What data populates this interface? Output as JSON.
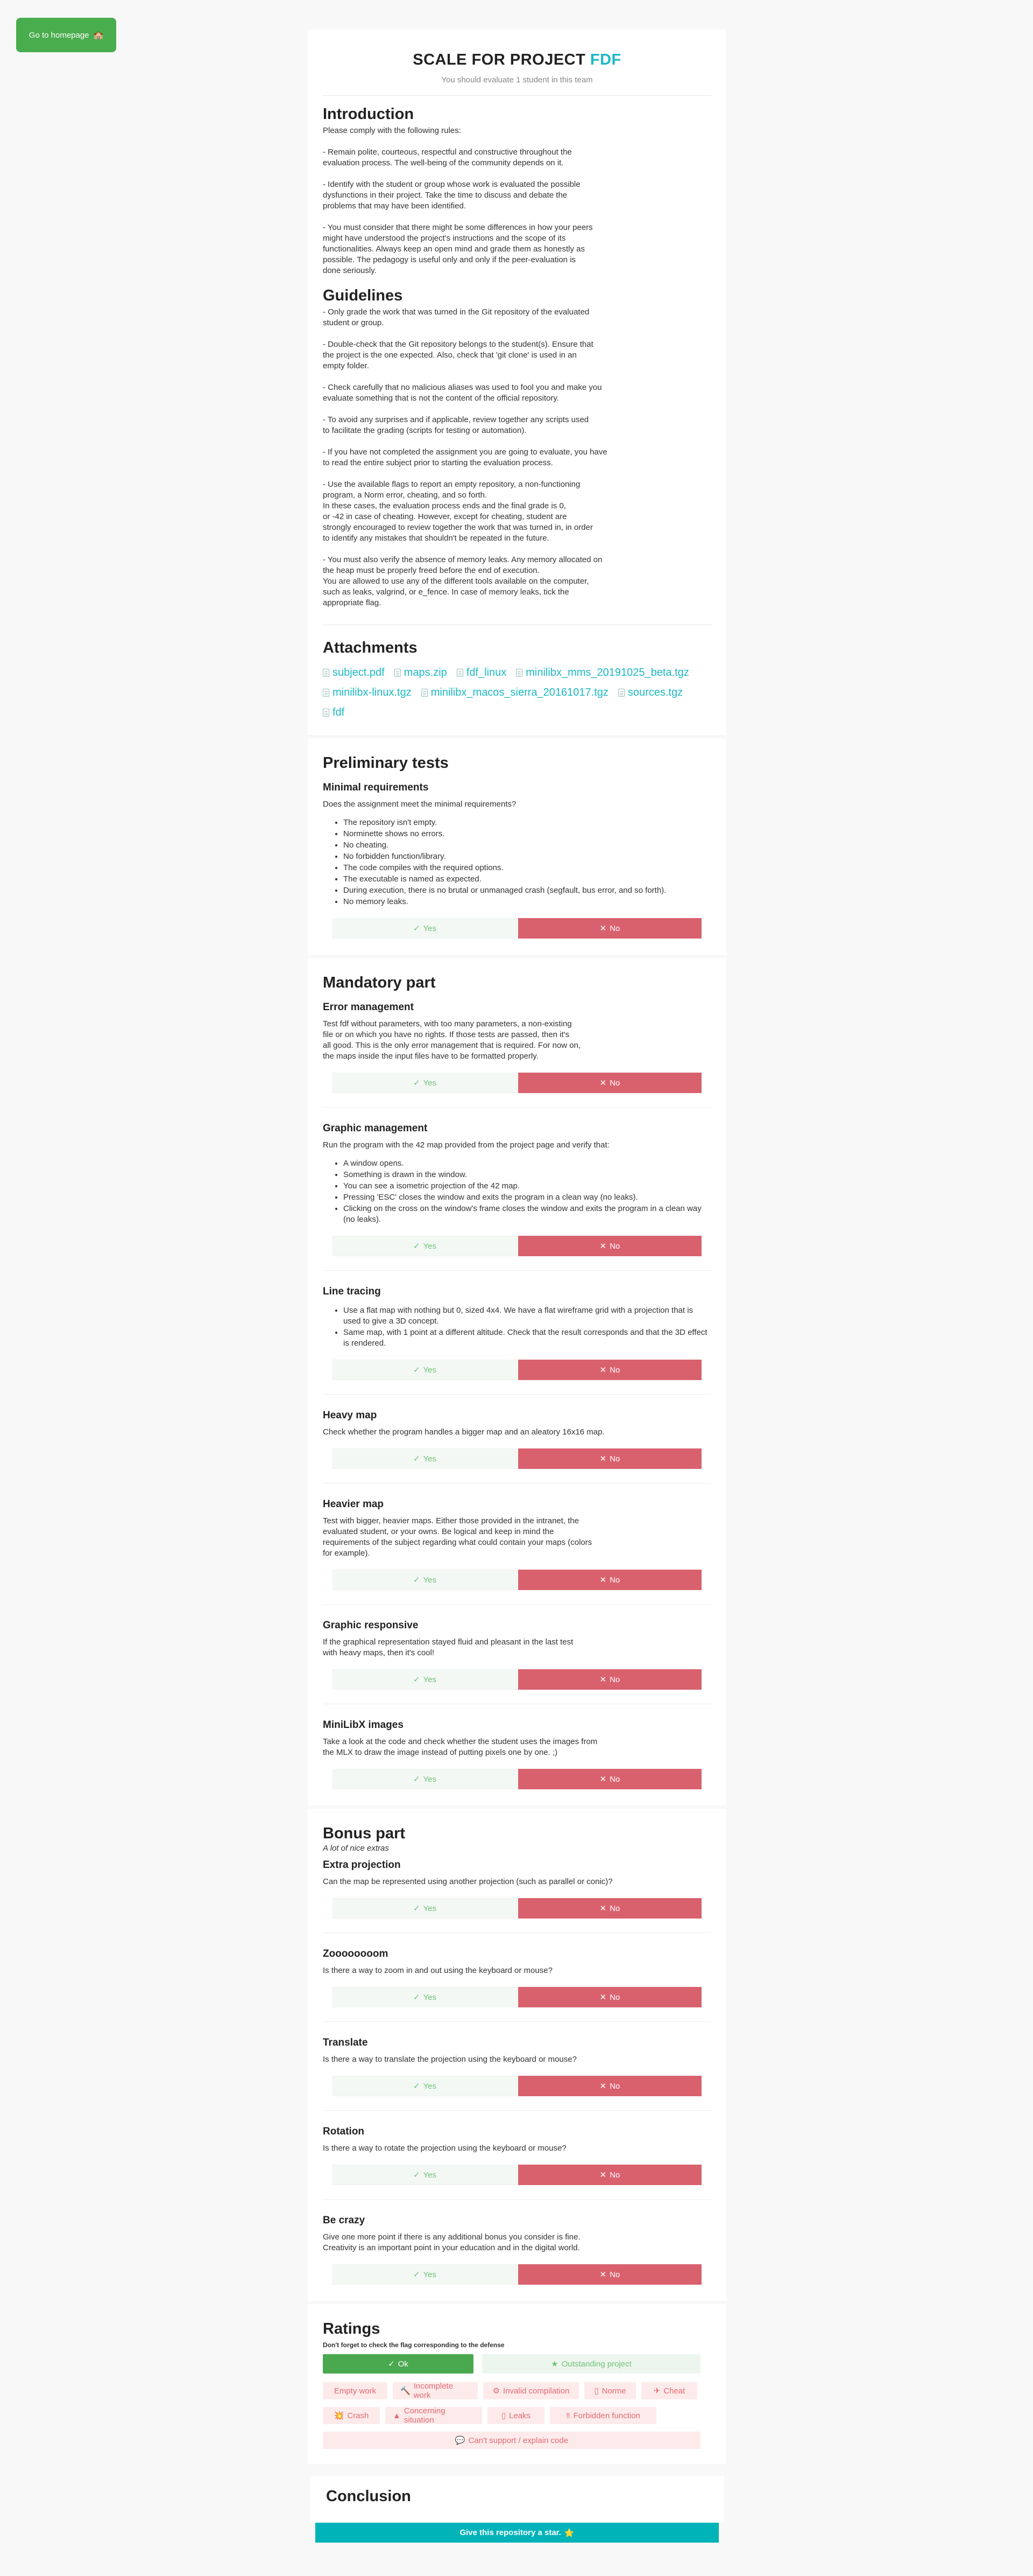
{
  "home_button": {
    "label": "Go to homepage",
    "icon": "school-icon"
  },
  "header": {
    "title_prefix": "SCALE FOR PROJECT",
    "title_project": "FDF",
    "subtitle": "You should evaluate 1 student in this team"
  },
  "colors": {
    "accent": "#1cb8c4",
    "yes": "#6fc275",
    "no": "#d9616e",
    "ok": "#4aa84f",
    "home": "#49ad4e",
    "star": "#00b3b8"
  },
  "introduction": {
    "title": "Introduction",
    "paragraphs": [
      "Please comply with the following rules:",
      "- Remain polite, courteous, respectful and constructive throughout the\nevaluation process. The well-being of the community depends on it.",
      "- Identify with the student or group whose work is evaluated the possible\ndysfunctions in their project. Take the time to discuss and debate the\nproblems that may have been identified.",
      "- You must consider that there might be some differences in how your peers\nmight have understood the project's instructions and the scope of its\nfunctionalities. Always keep an open mind and grade them as honestly as\npossible. The pedagogy is useful only and only if the peer-evaluation is\ndone seriously."
    ]
  },
  "guidelines": {
    "title": "Guidelines",
    "paragraphs": [
      "- Only grade the work that was turned in the Git repository of the evaluated\nstudent or group.",
      "- Double-check that the Git repository belongs to the student(s). Ensure that\nthe project is the one expected. Also, check that 'git clone' is used in an\nempty folder.",
      "- Check carefully that no malicious aliases was used to fool you and make you\nevaluate something that is not the content of the official repository.",
      "- To avoid any surprises and if applicable, review together any scripts used\nto facilitate the grading (scripts for testing or automation).",
      "- If you have not completed the assignment you are going to evaluate, you have\nto read the entire subject prior to starting the evaluation process.",
      "- Use the available flags to report an empty repository, a non-functioning\nprogram, a Norm error, cheating, and so forth.\nIn these cases, the evaluation process ends and the final grade is 0,\nor -42 in case of cheating. However, except for cheating, student are\nstrongly encouraged to review together the work that was turned in, in order\nto identify any mistakes that shouldn't be repeated in the future.",
      "- You must also verify the absence of memory leaks. Any memory allocated on\nthe heap must be properly freed before the end of execution.\nYou are allowed to use any of the different tools available on the computer,\nsuch as leaks, valgrind, or e_fence. In case of memory leaks, tick the\nappropriate flag."
    ]
  },
  "attachments": {
    "title": "Attachments",
    "files": [
      "subject.pdf",
      "maps.zip",
      "fdf_linux",
      "minilibx_mms_20191025_beta.tgz",
      "minilibx-linux.tgz",
      "minilibx_macos_sierra_20161017.tgz",
      "sources.tgz",
      "fdf"
    ]
  },
  "yes_label": "Yes",
  "no_label": "No",
  "preliminary": {
    "title": "Preliminary tests",
    "questions": [
      {
        "title": "Minimal requirements",
        "desc": "Does the assignment meet the minimal requirements?",
        "list": [
          "The repository isn't empty.",
          "Norminette shows no errors.",
          "No cheating.",
          "No forbidden function/library.",
          "The code compiles with the required options.",
          "The executable is named as expected.",
          "During execution, there is no brutal or unmanaged crash (segfault, bus error, and so forth).",
          "No memory leaks."
        ]
      }
    ]
  },
  "mandatory": {
    "title": "Mandatory part",
    "questions": [
      {
        "title": "Error management",
        "desc": "Test fdf without parameters, with too many parameters, a non-existing\nfile or on which you have no rights. If those tests are passed, then it's\nall good. This is the only error management that is required. For now on,\nthe maps inside the input files have to be formatted properly."
      },
      {
        "title": "Graphic management",
        "desc": "Run the program with the 42 map provided from the project page and verify that:",
        "list": [
          "A window opens.",
          "Something is drawn in the window.",
          "You can see a isometric projection of the 42 map.",
          "Pressing 'ESC' closes the window and exits the program in a clean way (no leaks).",
          "Clicking on the cross on the window's frame closes the window and exits the program in a clean way (no leaks)."
        ]
      },
      {
        "title": "Line tracing",
        "desc": "",
        "list": [
          "Use a flat map with nothing but 0, sized 4x4. We have a flat wireframe grid with a projection that is used to give a 3D concept.",
          "Same map, with 1 point at a different altitude. Check that the result corresponds and that the 3D effect is rendered."
        ]
      },
      {
        "title": "Heavy map",
        "desc": "Check whether the program handles a bigger map and an aleatory 16x16 map."
      },
      {
        "title": "Heavier map",
        "desc": "Test with bigger, heavier maps. Either those provided in the intranet, the\nevaluated student, or your owns. Be logical and keep in mind the\nrequirements of the subject regarding what could contain your maps (colors\nfor example)."
      },
      {
        "title": "Graphic responsive",
        "desc": "If the graphical representation stayed fluid and pleasant in the last test\nwith heavy maps, then it's cool!"
      },
      {
        "title": "MiniLibX images",
        "desc": "Take a look at the code and check whether the student uses the images from\nthe MLX to draw the image instead of putting pixels one by one. ;)"
      }
    ]
  },
  "bonus": {
    "title": "Bonus part",
    "subtitle": "A lot of nice extras",
    "questions": [
      {
        "title": "Extra projection",
        "desc": "Can the map be represented using another projection (such as parallel or conic)?"
      },
      {
        "title": "Zoooooooom",
        "desc": "Is there a way to zoom in and out using the keyboard or mouse?"
      },
      {
        "title": "Translate",
        "desc": "Is there a way to translate the projection using the keyboard or mouse?"
      },
      {
        "title": "Rotation",
        "desc": "Is there a way to rotate the projection using the keyboard or mouse?"
      },
      {
        "title": "Be crazy",
        "desc": "Give one more point if there is any additional bonus you consider is fine.\nCreativity is an important point in your education and in the digital world."
      }
    ]
  },
  "ratings": {
    "title": "Ratings",
    "note": "Don't forget to check the flag corresponding to the defense",
    "ok": "Ok",
    "outstanding": "Outstanding project",
    "flags": [
      "Empty work",
      "Incomplete work",
      "Invalid compilation",
      "Norme",
      "Cheat",
      "Crash",
      "Concerning situation",
      "Leaks",
      "Forbidden function"
    ],
    "cant_support": "Can't support / explain code"
  },
  "conclusion": {
    "title": "Conclusion",
    "star_button": "Give this repository a star."
  }
}
